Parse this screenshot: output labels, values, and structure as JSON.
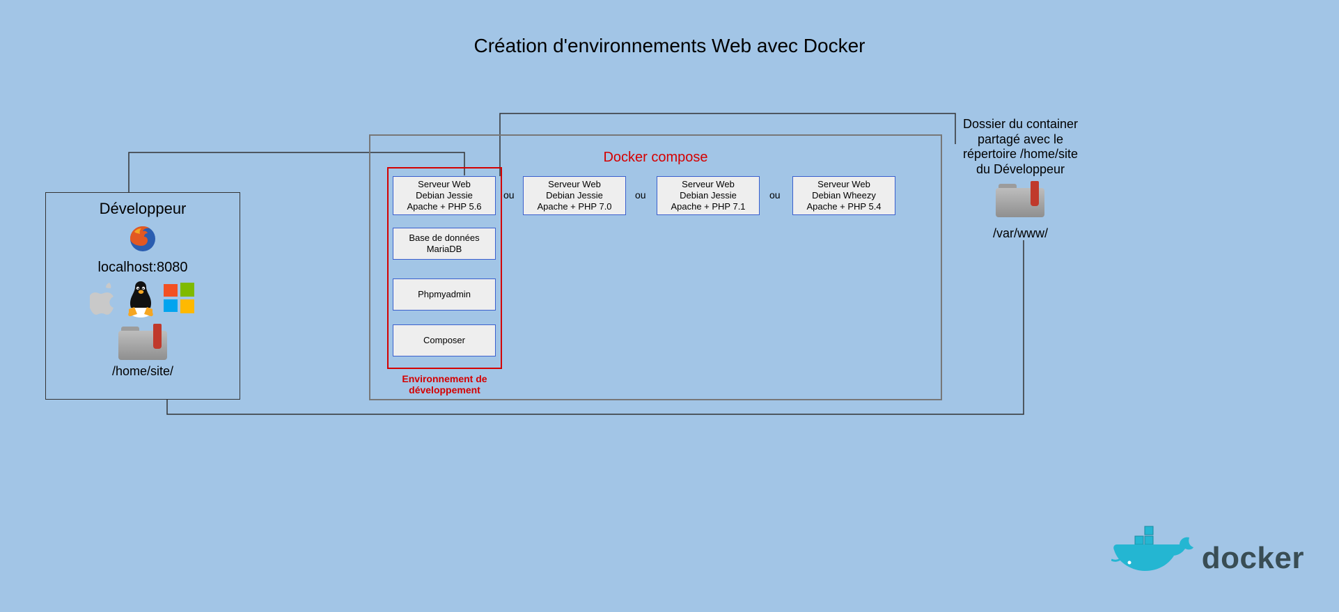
{
  "title": "Création d'environnements Web avec Docker",
  "developer": {
    "label": "Développeur",
    "url": "localhost:8080",
    "path": "/home/site/"
  },
  "compose": {
    "label": "Docker compose",
    "env_label": "Environnement de développement",
    "separator": "ou",
    "servers": [
      {
        "line1": "Serveur Web",
        "line2": "Debian Jessie",
        "line3": "Apache + PHP 5.6"
      },
      {
        "line1": "Serveur Web",
        "line2": "Debian Jessie",
        "line3": "Apache + PHP 7.0"
      },
      {
        "line1": "Serveur Web",
        "line2": "Debian Jessie",
        "line3": "Apache + PHP 7.1"
      },
      {
        "line1": "Serveur Web",
        "line2": "Debian Wheezy",
        "line3": "Apache + PHP 5.4"
      }
    ],
    "stack": [
      {
        "line1": "Base de données",
        "line2": "MariaDB"
      },
      {
        "line1": "Phpmyadmin"
      },
      {
        "line1": "Composer"
      }
    ]
  },
  "share": {
    "description": "Dossier du container partagé avec le répertoire /home/site du Développeur",
    "path": "/var/www/"
  },
  "logo": {
    "text": "docker"
  },
  "icons": {
    "firefox": "firefox-icon",
    "apple": "apple-icon",
    "linux": "linux-icon",
    "windows": "windows-icon",
    "folder": "folder-icon",
    "docker_whale": "docker-whale-icon"
  }
}
